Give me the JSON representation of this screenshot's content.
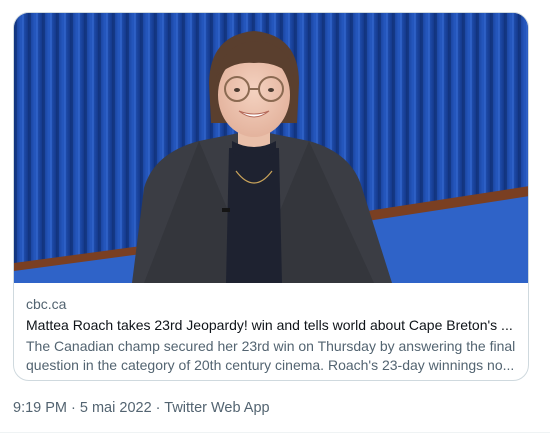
{
  "card": {
    "domain": "cbc.ca",
    "title": "Mattea Roach takes 23rd Jeopardy! win and tells world about Cape Breton's ...",
    "description": "The Canadian champ secured her 23rd win on Thursday by answering the final question in the category of 20th century cinema. Roach's 23-day winnings no..."
  },
  "meta": {
    "time": "9:19 PM",
    "separator": " · ",
    "date": "5 mai 2022",
    "source": "Twitter Web App"
  },
  "colors": {
    "curtain": "#1c4aa8",
    "stage_floor": "#2d60c4",
    "stage_edge": "#8a4a2a",
    "blazer": "#3a3c42",
    "secondary_text": "#536471",
    "primary_text": "#0f1419",
    "border": "#cfd9de"
  }
}
